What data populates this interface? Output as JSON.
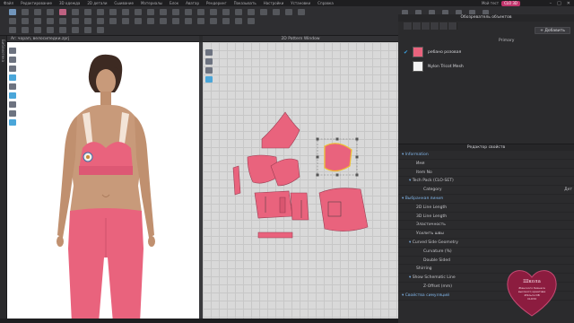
{
  "menubar": {
    "items": [
      "Файл",
      "Редактирование",
      "3D одежда",
      "2D детали",
      "Сшивание",
      "Материалы",
      "Блок",
      "Аватар",
      "Рендеринг",
      "Показывать",
      "Настройки",
      "Установки",
      "Справка"
    ],
    "brand_text": "Мой тест",
    "brand_badge": "CLO 3D"
  },
  "panes": {
    "view3d_title": "Ar: чорап, велосипедки.zprj",
    "view2d_title": "2D Pattern Window"
  },
  "object_browser": {
    "title": "Обозреватель объектов",
    "add_label": "Добавить",
    "primary_label": "Primary",
    "fabrics": [
      {
        "name": "ребано розовая",
        "swatch": "#e9637d",
        "selected": true
      },
      {
        "name": "Nylon Tricot Mesh",
        "swatch": "#f4f4f4",
        "selected": false
      }
    ]
  },
  "property_editor": {
    "title": "Редактор свойств",
    "rows": [
      {
        "label": "Information",
        "value": "",
        "kind": "section",
        "indent": 0
      },
      {
        "label": "Имя",
        "value": "",
        "kind": "row",
        "indent": 2
      },
      {
        "label": "Item No",
        "value": "",
        "kind": "row",
        "indent": 2
      },
      {
        "label": "Tech Pack (CLO-SET)",
        "value": "",
        "kind": "row",
        "indent": 1
      },
      {
        "label": "Category",
        "value": "Дет",
        "kind": "row",
        "indent": 3
      },
      {
        "label": "Выбранная линия",
        "value": "",
        "kind": "section",
        "indent": 0
      },
      {
        "label": "2D Line Length",
        "value": "",
        "kind": "row",
        "indent": 2
      },
      {
        "label": "3D Line Length",
        "value": "",
        "kind": "row",
        "indent": 2
      },
      {
        "label": "Эластичность",
        "value": "",
        "kind": "row",
        "indent": 2
      },
      {
        "label": "Усилить швы",
        "value": "",
        "kind": "row",
        "indent": 2
      },
      {
        "label": "Curved Side Geometry",
        "value": "",
        "kind": "row",
        "indent": 1
      },
      {
        "label": "Curvature (%)",
        "value": "",
        "kind": "row",
        "indent": 3
      },
      {
        "label": "Double Sided",
        "value": "",
        "kind": "row",
        "indent": 3
      },
      {
        "label": "Shirring",
        "value": "",
        "kind": "row",
        "indent": 2
      },
      {
        "label": "Show Schematic Line",
        "value": "",
        "kind": "row",
        "indent": 1
      },
      {
        "label": "Z-Offset (mm)",
        "value": "",
        "kind": "row",
        "indent": 3
      },
      {
        "label": "Свойства симуляций",
        "value": "",
        "kind": "section",
        "indent": 0
      }
    ]
  },
  "logo": {
    "line1": "Школа",
    "line2": "Женского бизнеса",
    "line3": "высокого креатива",
    "line4": "#Ольга DB",
    "line5": "CLO3d"
  },
  "colors": {
    "garment": "#e9637d",
    "accent": "#3aa0e0",
    "selection": "#f0c030"
  }
}
